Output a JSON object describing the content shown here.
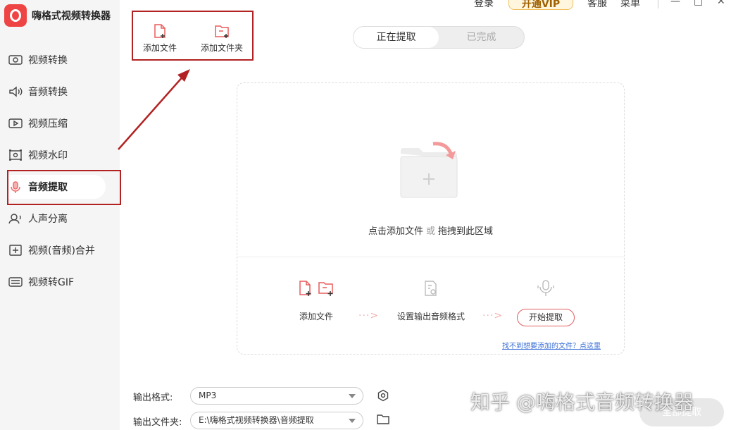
{
  "app": {
    "title": "嗨格式视频转换器",
    "brand_color": "#ef4444"
  },
  "header": {
    "login": "登录",
    "vip": "开通VIP",
    "service": "客服",
    "menu": "菜单",
    "minimize": "—",
    "maximize": "□",
    "close": "✕"
  },
  "sidebar": {
    "items": [
      {
        "label": "视频转换",
        "icon": "video-convert-icon"
      },
      {
        "label": "音频转换",
        "icon": "audio-convert-icon"
      },
      {
        "label": "视频压缩",
        "icon": "video-compress-icon"
      },
      {
        "label": "视频水印",
        "icon": "video-watermark-icon"
      },
      {
        "label": "音频提取",
        "icon": "audio-extract-icon",
        "active": true
      },
      {
        "label": "人声分离",
        "icon": "vocal-separate-icon"
      },
      {
        "label": "视频(音频)合并",
        "icon": "merge-icon"
      },
      {
        "label": "视频转GIF",
        "icon": "gif-icon"
      }
    ]
  },
  "toolbar": {
    "add_file": "添加文件",
    "add_folder": "添加文件夹"
  },
  "tabs": {
    "extracting": "正在提取",
    "completed": "已完成"
  },
  "dropzone": {
    "click_add": "点击添加文件",
    "or": "或",
    "drag_here": "拖拽到此区域",
    "steps": {
      "add_file": "添加文件",
      "set_format": "设置输出音频格式",
      "start": "开始提取"
    },
    "help_link": "找不到想要添加的文件？点这里"
  },
  "settings": {
    "format_label": "输出格式:",
    "format_value": "MP3",
    "folder_label": "输出文件夹:",
    "folder_value": "E:\\嗨格式视频转换器\\音频提取"
  },
  "watermark": "知乎 @嗨格式音频转换器",
  "all_extract": "全部提取",
  "colors": {
    "accent": "#ef6b6b",
    "annotation": "#b22222",
    "link": "#3b6fd6"
  }
}
